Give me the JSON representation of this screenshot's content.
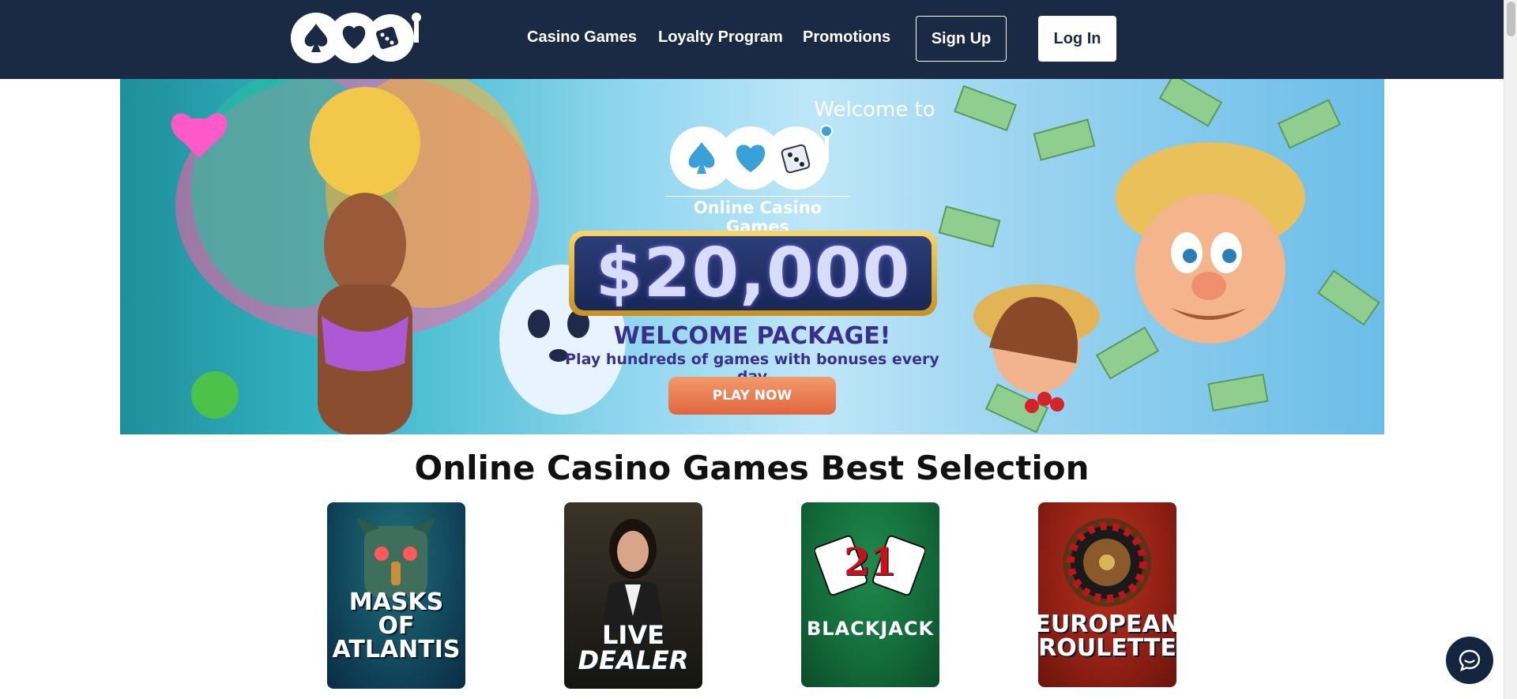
{
  "header": {
    "nav": [
      "Casino Games",
      "Loyalty Program",
      "Promotions"
    ],
    "signup_label": "Sign Up",
    "login_label": "Log In"
  },
  "banner": {
    "welcome_to": "Welcome to",
    "online_casino": "Online Casino Games",
    "amount": "$20,000",
    "welcome_package": "WELCOME PACKAGE!",
    "tagline": "Play hundreds of games with bonuses every day",
    "cta_label": "PLAY NOW"
  },
  "section": {
    "title": "Online Casino Games Best Selection"
  },
  "games": [
    {
      "label_line1": "MASKS OF",
      "label_line2": "ATLANTIS"
    },
    {
      "label_line1": "LIVE",
      "label_line2": "DEALER"
    },
    {
      "label_line1": "21",
      "label_line2": "BLACKJACK"
    },
    {
      "label_line1": "EUROPEAN",
      "label_line2": "ROULETTE"
    }
  ],
  "colors": {
    "header_bg": "#1b2a44",
    "cta": "#e0663f",
    "chat_bg": "#14253f"
  }
}
